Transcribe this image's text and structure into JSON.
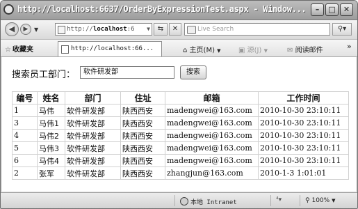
{
  "window": {
    "title": "http://localhost:6637/OrderByExpressionTest.aspx - Window..."
  },
  "address_bar": {
    "url_prefix": "http://",
    "url_host": "localhost",
    "url_suffix": ":6",
    "search_placeholder": "Live Search"
  },
  "favorites_bar": {
    "favorites_label": "收藏夹",
    "tab_title": "http://localhost:66...",
    "home_label": "主页(M)",
    "feeds_label": "源(J)",
    "read_mail_label": "阅读邮件",
    "overflow": "»"
  },
  "form": {
    "label": "搜索员工部门：",
    "department_value": "软件研发部",
    "search_button": "搜索"
  },
  "table": {
    "headers": [
      "编号",
      "姓名",
      "部门",
      "住址",
      "邮箱",
      "工作时间"
    ],
    "rows": [
      [
        "1",
        "马伟",
        "软件研发部",
        "陕西西安",
        "madengwei@163.com",
        "2010-10-30 23:10:11"
      ],
      [
        "3",
        "马伟1",
        "软件研发部",
        "陕西西安",
        "madengwei@163.com",
        "2010-10-30 23:10:11"
      ],
      [
        "4",
        "马伟2",
        "软件研发部",
        "陕西西安",
        "madengwei@163.com",
        "2010-10-30 23:10:11"
      ],
      [
        "5",
        "马伟3",
        "软件研发部",
        "陕西西安",
        "madengwei@163.com",
        "2010-10-30 23:10:11"
      ],
      [
        "6",
        "马伟4",
        "软件研发部",
        "陕西西安",
        "madengwei@163.com",
        "2010-10-30 23:10:11"
      ],
      [
        "2",
        "张军",
        "软件研发部",
        "陕西西安",
        "zhangjun@163.com",
        "2010-1-3 1:01:01"
      ]
    ]
  },
  "status_bar": {
    "zone": "本地 Intranet",
    "protected_mode": "⁴▾",
    "zoom": "100%"
  },
  "icons": {
    "ie": "ie-icon",
    "back": "back-arrow-icon",
    "forward": "forward-arrow-icon",
    "refresh": "refresh-icon",
    "stop": "stop-icon",
    "search": "search-icon",
    "favorites_star": "star-icon",
    "home": "home-icon",
    "feeds": "rss-icon",
    "mail": "mail-icon",
    "globe": "globe-icon"
  }
}
